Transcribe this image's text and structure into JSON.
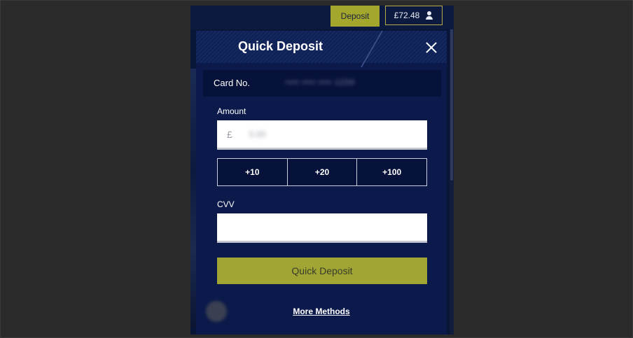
{
  "topbar": {
    "deposit_label": "Deposit",
    "balance": "£72.48"
  },
  "modal": {
    "title": "Quick Deposit",
    "card_label": "Card No.",
    "card_value": "•••• •••• •••• 1234",
    "amount_label": "Amount",
    "currency": "£",
    "amount_value": "5.00",
    "quick_amounts": [
      "+10",
      "+20",
      "+100"
    ],
    "cvv_label": "CVV",
    "cvv_value": "",
    "submit_label": "Quick Deposit",
    "more_methods": "More Methods"
  },
  "colors": {
    "accent": "#a3a72c",
    "panel": "#0b1a4a",
    "background": "#2b2b2b"
  }
}
